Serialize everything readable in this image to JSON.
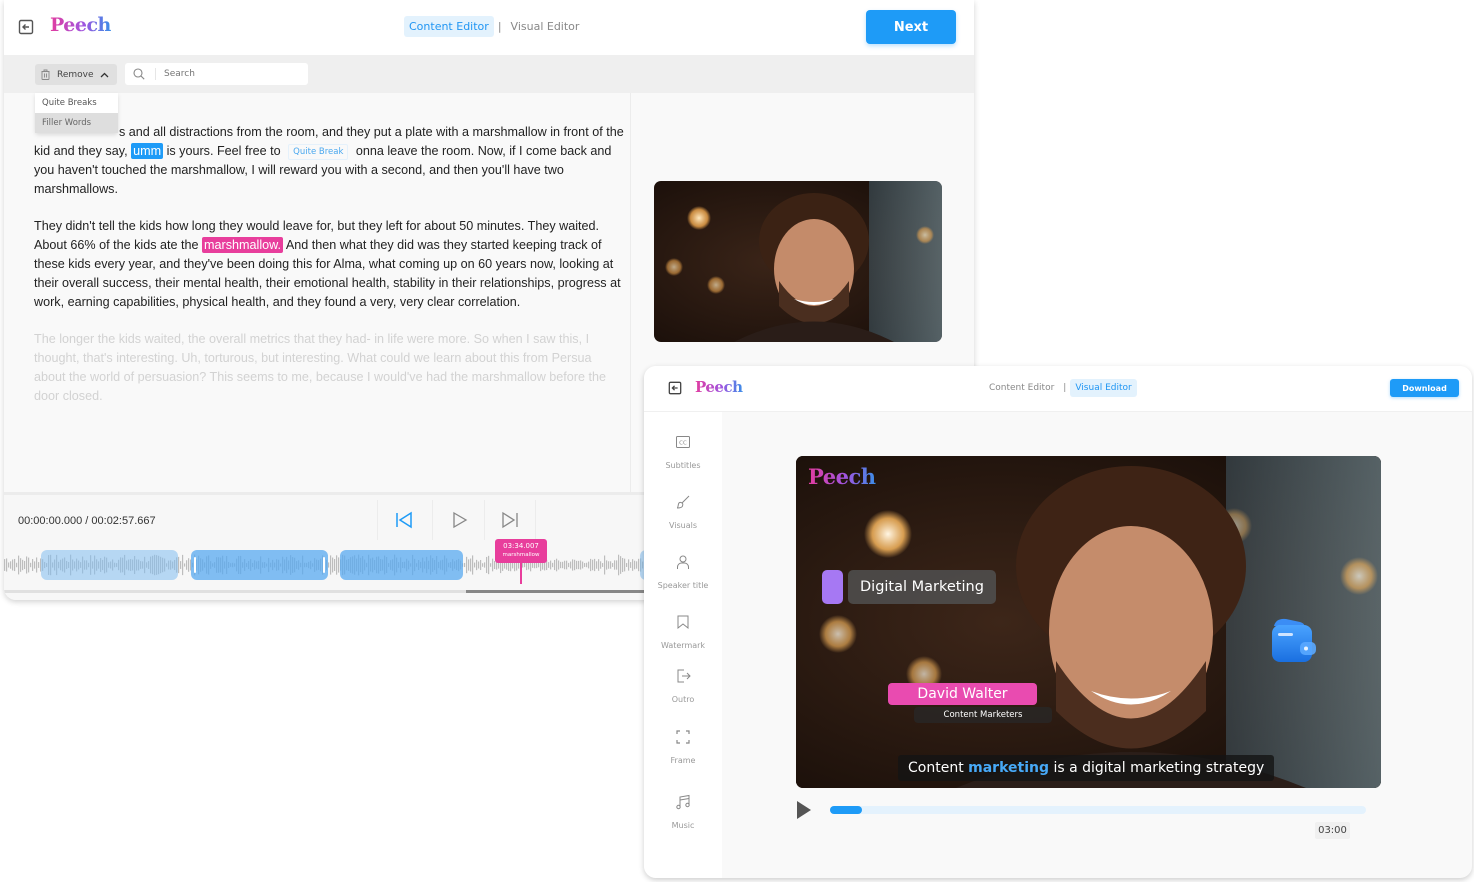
{
  "content_editor": {
    "logo": "Peech",
    "modes": [
      {
        "label": "Content Editor",
        "active": true
      },
      {
        "label": "Visual Editor",
        "active": false
      }
    ],
    "mode_separator": "|",
    "next_label": "Next",
    "toolbar": {
      "remove_label": "Remove",
      "search_placeholder": "Search",
      "remove_menu": [
        {
          "label": "Quite Breaks",
          "hovered": false
        },
        {
          "label": "Filler Words",
          "hovered": true
        }
      ]
    },
    "transcript": {
      "p1": {
        "a": "s and all distractions from the room, and they put a plate with a marshmallow in front of the kid and they say, ",
        "filler": "umm",
        "b": " is yours. Feel free to ",
        "break_tag": "Quite Break",
        "c": " onna leave the room. Now, if I come back and you haven't touched the marshmallow, I will reward you with a second, and then you'll have two marshmallows."
      },
      "p2": {
        "a": "They didn't tell the kids how long they would leave for, but they left for about 50 minutes. They waited. About 66% of the kids ate the ",
        "marked": "marshmallow.",
        "b": " And then what they did was they started keeping track of these kids every year, and they've been doing this for Alma, what coming up on 60 years now, looking at their overall success, their mental health, their emotional health, stability in their relationships, progress at work, earning capabilities, physical health, and they found a very, very clear correlation."
      },
      "p3": "The longer the kids waited, the overall metrics that they had- in life were more. So when I saw this, I thought, that's interesting. Uh, torturous, but  interesting. What could we learn about this from Persua about the world of persuasion? This seems to me, because I would've had the marshmallow before the door closed."
    },
    "player": {
      "timecode": "00:00:00.000 / 00:02:57.667",
      "marker_time": "03:34.007",
      "marker_word": "marshmallow"
    },
    "colors": {
      "accent": "#1e9bf7",
      "marked": "#e83e9c"
    }
  },
  "visual_editor": {
    "logo": "Peech",
    "modes": [
      {
        "label": "Content Editor",
        "active": false
      },
      {
        "label": "Visual Editor",
        "active": true
      }
    ],
    "mode_separator": "|",
    "download_label": "Download",
    "tools": [
      {
        "icon": "cc-icon",
        "label": "Subtitles"
      },
      {
        "icon": "brush-icon",
        "label": "Visuals"
      },
      {
        "icon": "user-icon",
        "label": "Speaker title"
      },
      {
        "icon": "bookmark-icon",
        "label": "Watermark"
      },
      {
        "icon": "exit-icon",
        "label": "Outro"
      },
      {
        "icon": "frame-icon",
        "label": "Frame"
      },
      {
        "icon": "music-icon",
        "label": "Music"
      }
    ],
    "video": {
      "watermark": "Peech",
      "topic": "Digital Marketing",
      "speaker_name": "David Walter",
      "speaker_role": "Content Marketers",
      "subtitle_before": "Content ",
      "subtitle_keyword": "marketing",
      "subtitle_after": " is a digital marketing strategy"
    },
    "player": {
      "progress_percent": 6,
      "duration": "03:00"
    },
    "colors": {
      "speaker_name_bg": "#e94bb0",
      "topic_chip": "#a678f3",
      "keyword": "#47a9f7"
    }
  }
}
